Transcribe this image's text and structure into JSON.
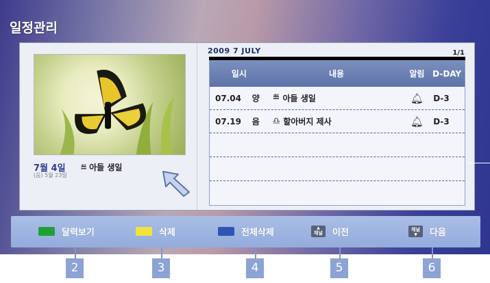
{
  "window": {
    "title": "일정관리"
  },
  "selection": {
    "date": "7월 4일",
    "lunar": "(음) 5월 23일",
    "event_icon": "cake-icon",
    "event": "아들 생일"
  },
  "calendar": {
    "month_label": "2009  7  JULY",
    "page": "1/1"
  },
  "table": {
    "headers": {
      "date": "일시",
      "content": "내용",
      "alarm": "알림",
      "dday": "D-DAY"
    },
    "rows": [
      {
        "date": "07.04",
        "type": "양",
        "icon": "cake-icon",
        "content": "아들 생일",
        "alarm_icon": "bell-icon",
        "dday": "D-3"
      },
      {
        "date": "07.19",
        "type": "음",
        "icon": "memorial-icon",
        "content": "할아버지 제사",
        "alarm_icon": "bell-icon",
        "dday": "D-3"
      }
    ]
  },
  "buttons": {
    "calendar_view": {
      "label": "달력보기",
      "color": "#1fa035"
    },
    "delete": {
      "label": "삭제",
      "color": "#f2e33b"
    },
    "delete_all": {
      "label": "전체삭제",
      "color": "#2f55b4"
    },
    "prev": {
      "label": "이전",
      "key": "채널"
    },
    "next": {
      "label": "다음",
      "key": "채널"
    }
  },
  "callouts": [
    "2",
    "3",
    "4",
    "5",
    "6"
  ]
}
